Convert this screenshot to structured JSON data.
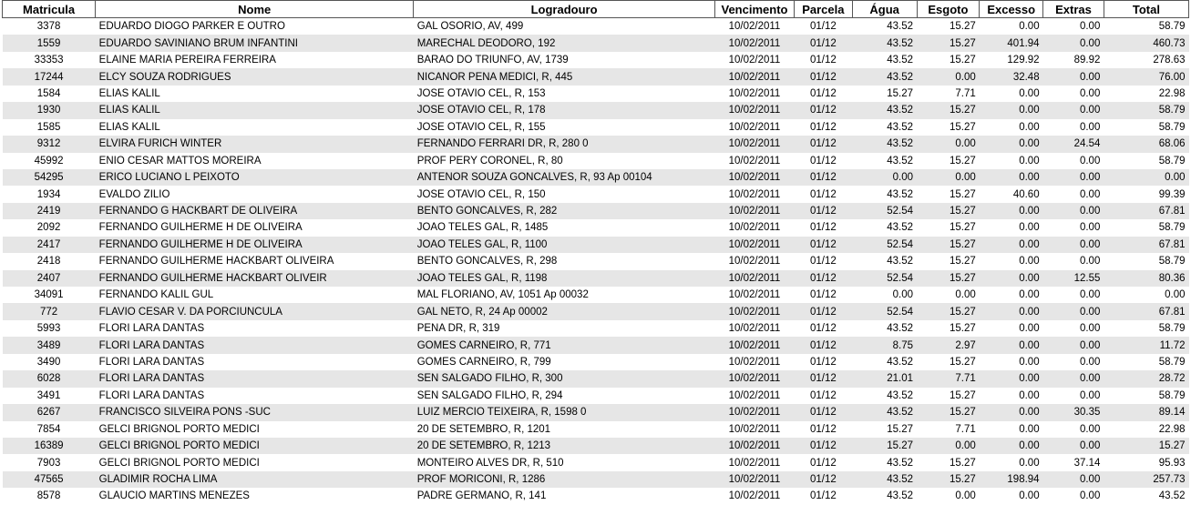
{
  "headers": {
    "matricula": "Matricula",
    "nome": "Nome",
    "logradouro": "Logradouro",
    "vencimento": "Vencimento",
    "parcela": "Parcela",
    "agua": "Água",
    "esgoto": "Esgoto",
    "excesso": "Excesso",
    "extras": "Extras",
    "total": "Total"
  },
  "rows": [
    [
      "3378",
      "EDUARDO DIOGO PARKER E OUTRO",
      "GAL OSORIO, AV, 499",
      "10/02/2011",
      "01/12",
      "43.52",
      "15.27",
      "0.00",
      "0.00",
      "58.79"
    ],
    [
      "1559",
      "EDUARDO SAVINIANO BRUM INFANTINI",
      "MARECHAL DEODORO, 192",
      "10/02/2011",
      "01/12",
      "43.52",
      "15.27",
      "401.94",
      "0.00",
      "460.73"
    ],
    [
      "33353",
      "ELAINE MARIA PEREIRA FERREIRA",
      "BARAO DO TRIUNFO, AV, 1739",
      "10/02/2011",
      "01/12",
      "43.52",
      "15.27",
      "129.92",
      "89.92",
      "278.63"
    ],
    [
      "17244",
      "ELCY SOUZA RODRIGUES",
      "NICANOR PENA MEDICI, R, 445",
      "10/02/2011",
      "01/12",
      "43.52",
      "0.00",
      "32.48",
      "0.00",
      "76.00"
    ],
    [
      "1584",
      "ELIAS KALIL",
      "JOSE OTAVIO CEL, R, 153",
      "10/02/2011",
      "01/12",
      "15.27",
      "7.71",
      "0.00",
      "0.00",
      "22.98"
    ],
    [
      "1930",
      "ELIAS KALIL",
      "JOSE OTAVIO CEL, R, 178",
      "10/02/2011",
      "01/12",
      "43.52",
      "15.27",
      "0.00",
      "0.00",
      "58.79"
    ],
    [
      "1585",
      "ELIAS KALIL",
      "JOSE OTAVIO CEL, R, 155",
      "10/02/2011",
      "01/12",
      "43.52",
      "15.27",
      "0.00",
      "0.00",
      "58.79"
    ],
    [
      "9312",
      "ELVIRA FURICH WINTER",
      "FERNANDO FERRARI DR, R, 280  0",
      "10/02/2011",
      "01/12",
      "43.52",
      "0.00",
      "0.00",
      "24.54",
      "68.06"
    ],
    [
      "45992",
      "ENIO CESAR MATTOS MOREIRA",
      "PROF PERY CORONEL, R, 80",
      "10/02/2011",
      "01/12",
      "43.52",
      "15.27",
      "0.00",
      "0.00",
      "58.79"
    ],
    [
      "54295",
      "ERICO LUCIANO L PEIXOTO",
      "ANTENOR SOUZA GONCALVES, R, 93  Ap 00104",
      "10/02/2011",
      "01/12",
      "0.00",
      "0.00",
      "0.00",
      "0.00",
      "0.00"
    ],
    [
      "1934",
      "EVALDO ZILIO",
      "JOSE OTAVIO CEL, R, 150",
      "10/02/2011",
      "01/12",
      "43.52",
      "15.27",
      "40.60",
      "0.00",
      "99.39"
    ],
    [
      "2419",
      "FERNANDO G HACKBART DE OLIVEIRA",
      "BENTO GONCALVES, R, 282",
      "10/02/2011",
      "01/12",
      "52.54",
      "15.27",
      "0.00",
      "0.00",
      "67.81"
    ],
    [
      "2092",
      "FERNANDO GUILHERME H DE OLIVEIRA",
      "JOAO TELES GAL, R, 1485",
      "10/02/2011",
      "01/12",
      "43.52",
      "15.27",
      "0.00",
      "0.00",
      "58.79"
    ],
    [
      "2417",
      "FERNANDO GUILHERME H DE OLIVEIRA",
      "JOAO TELES GAL, R, 1100",
      "10/02/2011",
      "01/12",
      "52.54",
      "15.27",
      "0.00",
      "0.00",
      "67.81"
    ],
    [
      "2418",
      "FERNANDO GUILHERME HACKBART OLIVEIRA",
      "BENTO GONCALVES, R, 298",
      "10/02/2011",
      "01/12",
      "43.52",
      "15.27",
      "0.00",
      "0.00",
      "58.79"
    ],
    [
      "2407",
      "FERNANDO GUILHERME HACKBART OLIVEIR",
      "JOAO TELES GAL, R, 1198",
      "10/02/2011",
      "01/12",
      "52.54",
      "15.27",
      "0.00",
      "12.55",
      "80.36"
    ],
    [
      "34091",
      "FERNANDO KALIL GUL",
      "MAL FLORIANO, AV, 1051  Ap 00032",
      "10/02/2011",
      "01/12",
      "0.00",
      "0.00",
      "0.00",
      "0.00",
      "0.00"
    ],
    [
      "772",
      "FLAVIO CESAR V. DA PORCIUNCULA",
      "GAL NETO, R, 24  Ap 00002",
      "10/02/2011",
      "01/12",
      "52.54",
      "15.27",
      "0.00",
      "0.00",
      "67.81"
    ],
    [
      "5993",
      "FLORI LARA DANTAS",
      "PENA DR, R, 319",
      "10/02/2011",
      "01/12",
      "43.52",
      "15.27",
      "0.00",
      "0.00",
      "58.79"
    ],
    [
      "3489",
      "FLORI LARA DANTAS",
      "GOMES CARNEIRO, R, 771",
      "10/02/2011",
      "01/12",
      "8.75",
      "2.97",
      "0.00",
      "0.00",
      "11.72"
    ],
    [
      "3490",
      "FLORI LARA DANTAS",
      "GOMES CARNEIRO, R, 799",
      "10/02/2011",
      "01/12",
      "43.52",
      "15.27",
      "0.00",
      "0.00",
      "58.79"
    ],
    [
      "6028",
      "FLORI LARA DANTAS",
      "SEN SALGADO FILHO, R, 300",
      "10/02/2011",
      "01/12",
      "21.01",
      "7.71",
      "0.00",
      "0.00",
      "28.72"
    ],
    [
      "3491",
      "FLORI LARA DANTAS",
      "SEN SALGADO FILHO, R, 294",
      "10/02/2011",
      "01/12",
      "43.52",
      "15.27",
      "0.00",
      "0.00",
      "58.79"
    ],
    [
      "6267",
      "FRANCISCO SILVEIRA PONS -SUC",
      "LUIZ MERCIO TEIXEIRA, R, 1598  0",
      "10/02/2011",
      "01/12",
      "43.52",
      "15.27",
      "0.00",
      "30.35",
      "89.14"
    ],
    [
      "7854",
      "GELCI BRIGNOL PORTO MEDICI",
      "20 DE SETEMBRO, R, 1201",
      "10/02/2011",
      "01/12",
      "15.27",
      "7.71",
      "0.00",
      "0.00",
      "22.98"
    ],
    [
      "16389",
      "GELCI BRIGNOL PORTO MEDICI",
      "20 DE SETEMBRO, R, 1213",
      "10/02/2011",
      "01/12",
      "15.27",
      "0.00",
      "0.00",
      "0.00",
      "15.27"
    ],
    [
      "7903",
      "GELCI BRIGNOL PORTO MEDICI",
      "MONTEIRO ALVES DR, R, 510",
      "10/02/2011",
      "01/12",
      "43.52",
      "15.27",
      "0.00",
      "37.14",
      "95.93"
    ],
    [
      "47565",
      "GLADIMIR ROCHA LIMA",
      "PROF MORICONI, R, 1286",
      "10/02/2011",
      "01/12",
      "43.52",
      "15.27",
      "198.94",
      "0.00",
      "257.73"
    ],
    [
      "8578",
      "GLAUCIO MARTINS MENEZES",
      "PADRE GERMANO, R, 141",
      "10/02/2011",
      "01/12",
      "43.52",
      "0.00",
      "0.00",
      "0.00",
      "43.52"
    ]
  ]
}
